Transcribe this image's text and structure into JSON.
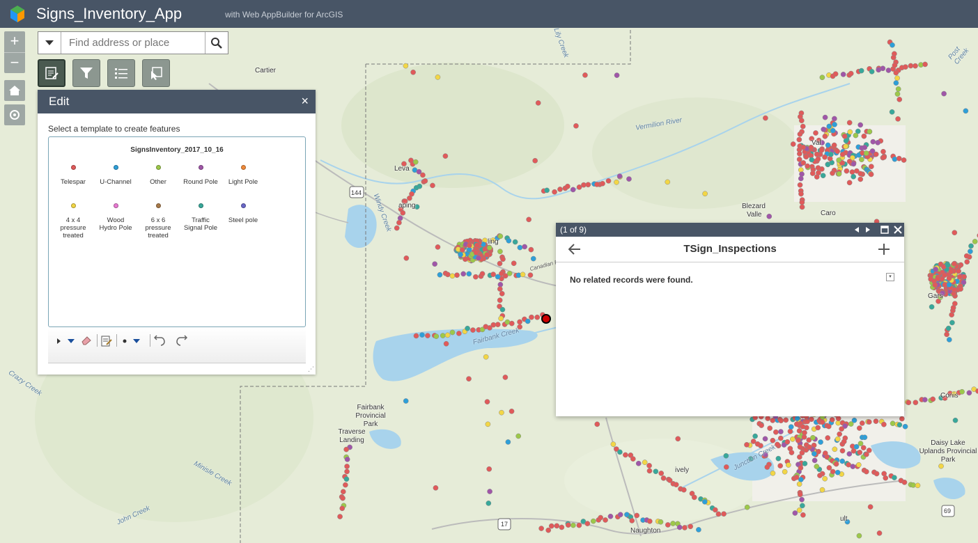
{
  "header": {
    "title": "Signs_Inventory_App",
    "subtitle": "with Web AppBuilder for ArcGIS"
  },
  "map_controls": {
    "zoom_in": "+",
    "zoom_out": "−"
  },
  "search": {
    "placeholder": "Find address or place"
  },
  "edit_panel": {
    "title": "Edit",
    "close": "×",
    "instruction": "Select a template to create features",
    "layer_name": "SignsInventory_2017_10_16",
    "templates": [
      {
        "label": "Telespar",
        "color": "#e05a5a"
      },
      {
        "label": "U-Channel",
        "color": "#2e9fd8"
      },
      {
        "label": "Other",
        "color": "#9dc84a"
      },
      {
        "label": "Round Pole",
        "color": "#a056a8"
      },
      {
        "label": "Light Pole",
        "color": "#f08a3a"
      },
      {
        "label": "4 x 4 pressure treated",
        "color": "#f2d646"
      },
      {
        "label": "Wood Hydro Pole",
        "color": "#e87ad2"
      },
      {
        "label": "6 x 6 pressure treated",
        "color": "#a87a4a"
      },
      {
        "label": "Traffic Signal Pole",
        "color": "#38a89a"
      },
      {
        "label": "Steel pole",
        "color": "#6a68c8"
      }
    ]
  },
  "popup": {
    "counter": "(1 of 9)",
    "title": "TSign_Inspections",
    "message": "No related records were found."
  },
  "map_labels": {
    "cartier": "Cartier",
    "levack": "Leva",
    "naughton_ish": "aping",
    "ling": "ling",
    "blezard": "Blezard",
    "valley": "Valle",
    "val_therese": "Val",
    "caron": "Caro",
    "garson": "Gars",
    "coniston": "Conis",
    "fairbank_park": "Fairbank Provincial Park",
    "traverse": "Traverse Landing",
    "daisy": "Daisy Lake Uplands Provincial Park",
    "naughton": "Naughton",
    "lively": "ively",
    "walden": "ult",
    "hwy144": "144",
    "hwy17": "17",
    "hwy69": "69"
  },
  "water_labels": {
    "vermilion": "Vermilion River",
    "fairbank_creek": "Fairbank Creek",
    "junction_creek": "Junction Creek",
    "crazy_creek": "Crazy Creek",
    "minnow_creek": "Minisle Creek",
    "john_creek": "John Creek",
    "windy_creek": "Windy Creek",
    "canadian_river": "Canadian Riv",
    "post_creek": "Post Creek",
    "lily_creek": "Lily Creek"
  }
}
